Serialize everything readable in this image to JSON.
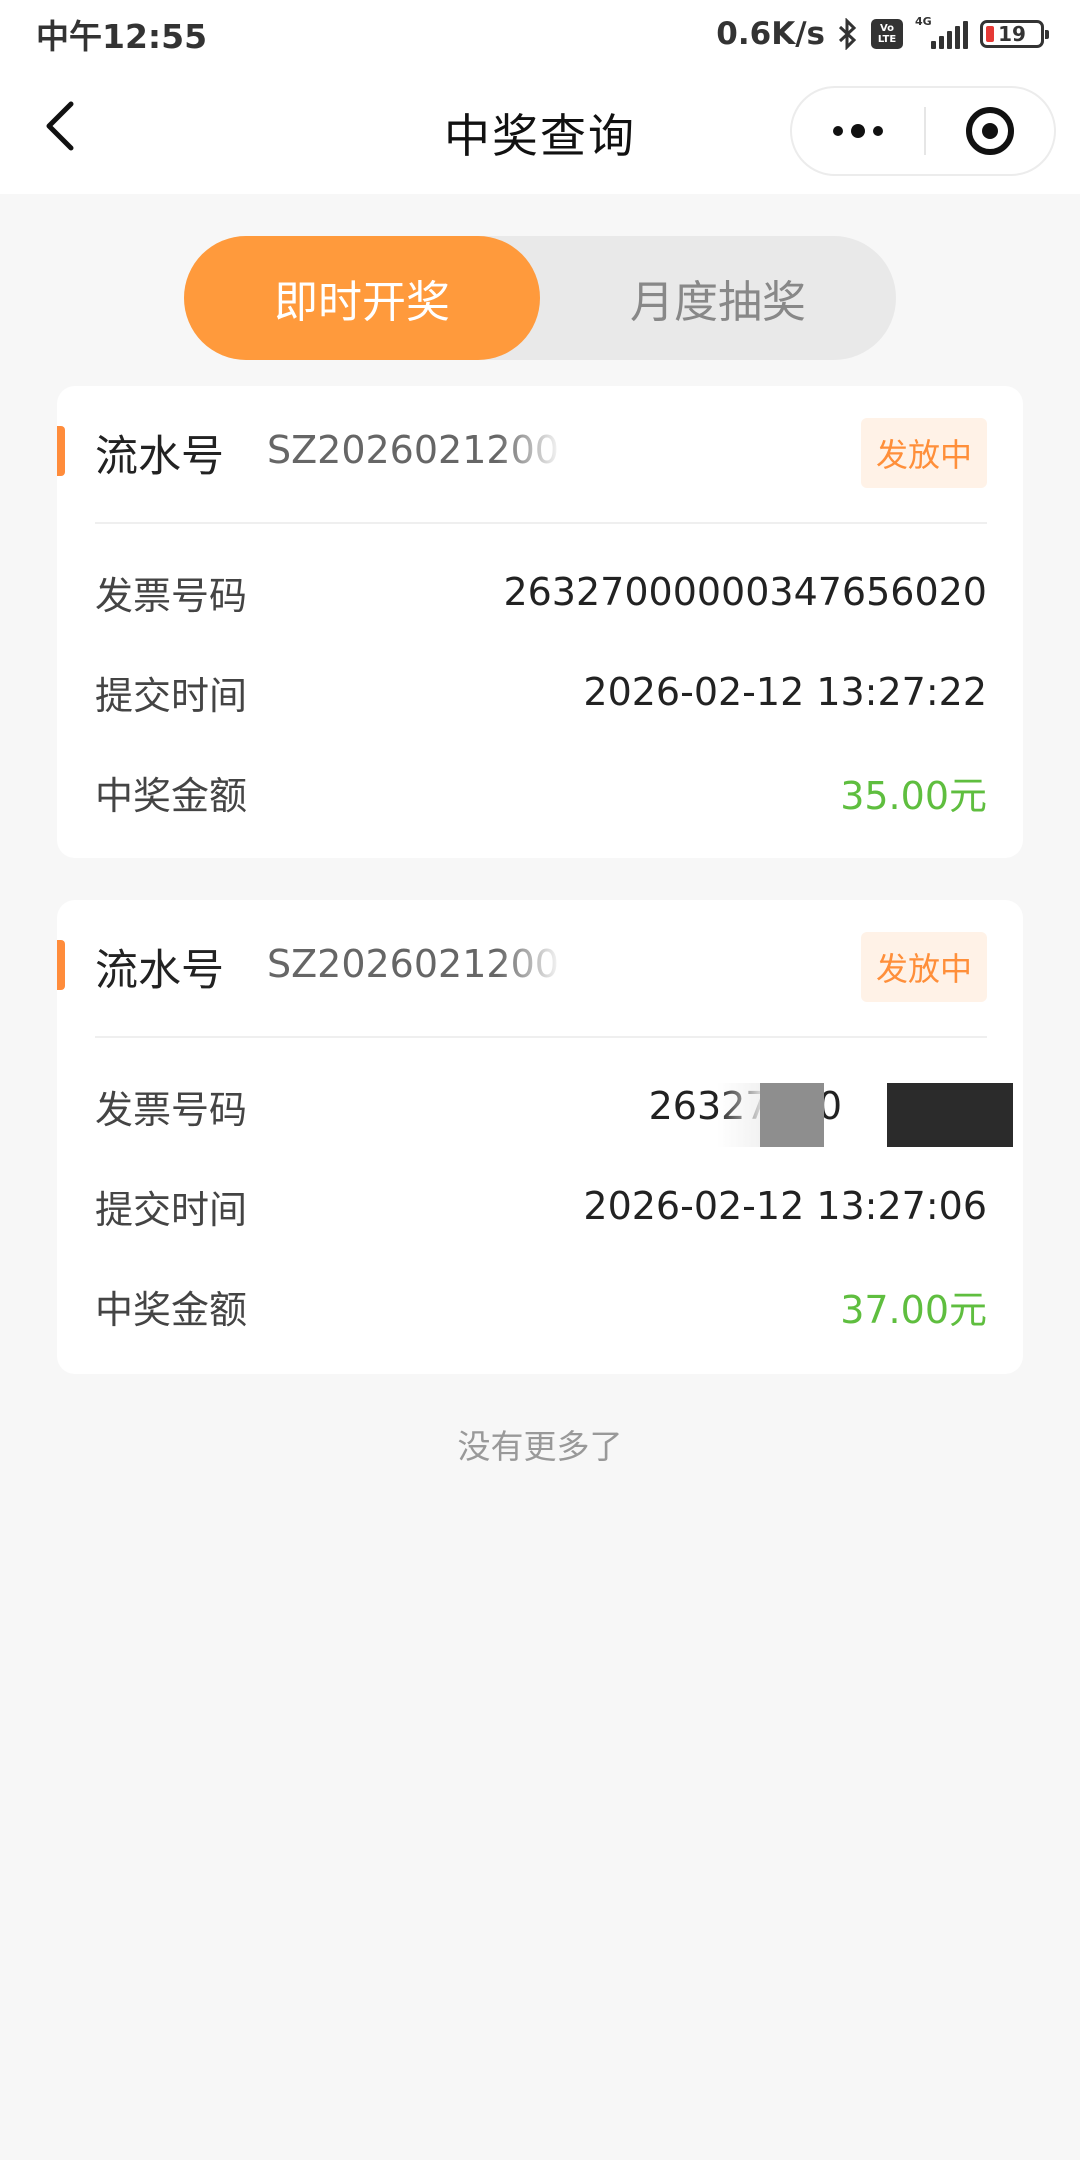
{
  "status_bar": {
    "time": "中午12:55",
    "net_speed": "0.6K/s",
    "volte_line1": "Vo",
    "volte_line2": "LTE",
    "signal_label": "4G",
    "battery_level": "19",
    "icons": [
      "bluetooth-icon",
      "volte-icon",
      "signal-icon",
      "battery-icon"
    ]
  },
  "nav": {
    "title": "中奖查询",
    "back_icon": "chevron-left-icon",
    "more_icon": "more-dots-icon",
    "close_icon": "target-close-icon"
  },
  "tabs": [
    {
      "label": "即时开奖",
      "active": true
    },
    {
      "label": "月度抽奖",
      "active": false
    }
  ],
  "colors": {
    "accent": "#ff9a3c",
    "badge_text": "#ff8f3a",
    "badge_bg": "#fff2e7",
    "amount": "#5fbe3f",
    "background": "#f7f7f7"
  },
  "records": [
    {
      "serial_label": "流水号",
      "serial_value": "SZ2026021200",
      "status": "发放中",
      "fields": [
        {
          "label": "发票号码",
          "value": "26327000000347656020"
        },
        {
          "label": "提交时间",
          "value": "2026-02-12 13:27:22"
        },
        {
          "label": "中奖金额",
          "value": "35.00元"
        }
      ]
    },
    {
      "serial_label": "流水号",
      "serial_value": "SZ2026021200",
      "status": "发放中",
      "fields": [
        {
          "label": "发票号码",
          "value": "26327000        65"
        },
        {
          "label": "提交时间",
          "value": "2026-02-12 13:27:06"
        },
        {
          "label": "中奖金额",
          "value": "37.00元"
        }
      ]
    }
  ],
  "footer": {
    "end_text": "没有更多了"
  }
}
